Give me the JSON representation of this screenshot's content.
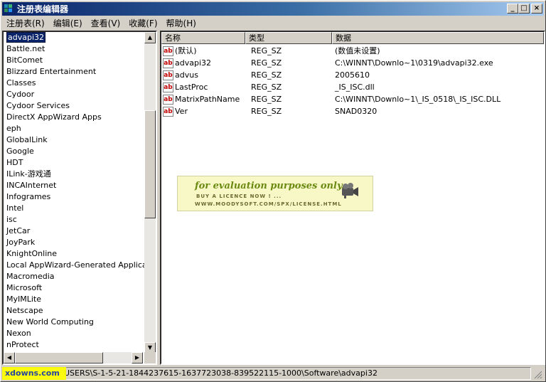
{
  "window": {
    "title": "注册表编辑器",
    "controls": [
      "_",
      "□",
      "×"
    ]
  },
  "menu": [
    "注册表(R)",
    "编辑(E)",
    "查看(V)",
    "收藏(F)",
    "帮助(H)"
  ],
  "tree": [
    "advapi32",
    "Battle.net",
    "BitComet",
    "Blizzard Entertainment",
    "Classes",
    "Cydoor",
    "Cydoor Services",
    "DirectX AppWizard Apps",
    "eph",
    "GlobalLink",
    "Google",
    "HDT",
    "ILink-游戏通",
    "INCAInternet",
    "Infogrames",
    "Intel",
    "isc",
    "JetCar",
    "JoyPark",
    "KnightOnline",
    "Local AppWizard-Generated Applications",
    "Macromedia",
    "Microsoft",
    "MyIMLite",
    "Netscape",
    "New World Computing",
    "Nexon",
    "nProtect"
  ],
  "columns": [
    "名称",
    "类型",
    "数据"
  ],
  "values": [
    {
      "name": "(默认)",
      "type": "REG_SZ",
      "data": "(数值未设置)"
    },
    {
      "name": "advapi32",
      "type": "REG_SZ",
      "data": "C:\\WINNT\\Downlo~1\\0319\\advapi32.exe"
    },
    {
      "name": "advus",
      "type": "REG_SZ",
      "data": "2005610"
    },
    {
      "name": "LastProc",
      "type": "REG_SZ",
      "data": "_IS_ISC.dll"
    },
    {
      "name": "MatrixPathName",
      "type": "REG_SZ",
      "data": "C:\\WINNT\\Downlo~1\\_IS_0518\\_IS_ISC.DLL"
    },
    {
      "name": "Ver",
      "type": "REG_SZ",
      "data": "SNAD0320"
    }
  ],
  "watermark": {
    "line1": "for evaluation purposes only.",
    "line2": "BUY A LICENCE NOW ! ...",
    "line3": "WWW.MOODYSOFT.COM/SPX/LICENSE.HTML"
  },
  "status": "USERS\\S-1-5-21-1844237615-1637723038-839522115-1000\\Software\\advapi32",
  "logo": "xdowns.com"
}
